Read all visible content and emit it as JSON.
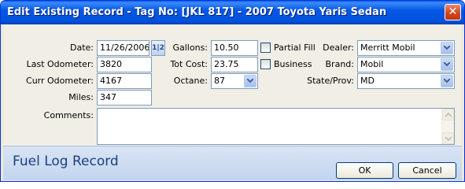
{
  "window": {
    "title": "Edit Existing Record - Tag No: [JKL 817] - 2007 Toyota Yaris Sedan"
  },
  "form": {
    "date_label": "Date:",
    "date_value": "11/26/2006",
    "last_odometer_label": "Last Odometer:",
    "last_odometer_value": "3820",
    "curr_odometer_label": "Curr Odometer:",
    "curr_odometer_value": "4167",
    "miles_label": "Miles:",
    "miles_value": "347",
    "gallons_label": "Gallons:",
    "gallons_value": "10.50",
    "tot_cost_label": "Tot Cost:",
    "tot_cost_value": "23.75",
    "octane_label": "Octane:",
    "octane_value": "87",
    "partial_fill_label": "Partial Fill",
    "partial_fill_checked": false,
    "business_label": "Business",
    "business_checked": false,
    "dealer_label": "Dealer:",
    "dealer_value": "Merritt Mobil",
    "brand_label": "Brand:",
    "brand_value": "Mobil",
    "state_label": "State/Prov:",
    "state_value": "MD",
    "comments_label": "Comments:",
    "comments_value": ""
  },
  "footer": {
    "title": "Fuel Log Record",
    "ok_label": "OK",
    "cancel_label": "Cancel"
  },
  "colors": {
    "titlebar": "#0557e6",
    "footer_text": "#1c3f80"
  }
}
